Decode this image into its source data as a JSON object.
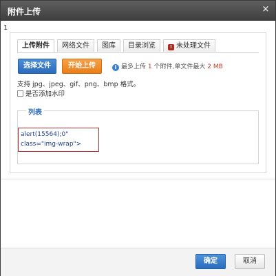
{
  "dialog": {
    "title": "附件上传",
    "close_glyph": "×",
    "stray_text": "1"
  },
  "tabs": [
    {
      "label": "上传附件",
      "active": true
    },
    {
      "label": "网络文件",
      "active": false
    },
    {
      "label": "图库",
      "active": false
    },
    {
      "label": "目录浏览",
      "active": false
    },
    {
      "label": "未处理文件",
      "active": false,
      "icon": "warning-badge-icon",
      "icon_glyph": "!"
    }
  ],
  "upload": {
    "select_label": "选择文件",
    "start_label": "开始上传",
    "info_icon": "i",
    "info_prefix": "最多上传",
    "max_files": "1",
    "info_middle": "个附件,单文件最大",
    "max_size": "2 MB",
    "formats_text": "支持 jpg、jpeg、gif、png、bmp 格式。",
    "watermark_label": "是否添加水印"
  },
  "list": {
    "legend": "列表",
    "code_line1": "alert(15564);0\"",
    "code_line2": "class=\"img-wrap\">"
  },
  "footer": {
    "ok_label": "确定",
    "cancel_label": "取消"
  },
  "colors": {
    "primary": "#2b6cbf",
    "warning": "#ea7d16",
    "highlight": "#c0392b",
    "titlebar": "#4a4a4a"
  }
}
